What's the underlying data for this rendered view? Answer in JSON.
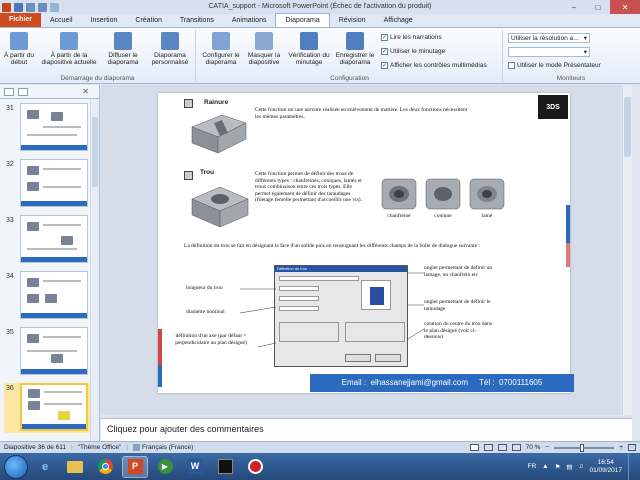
{
  "window": {
    "title": "CATIA_support - Microsoft PowerPoint (Échec de l'activation du produit)"
  },
  "tabs": [
    "Fichier",
    "Accueil",
    "Insertion",
    "Création",
    "Transitions",
    "Animations",
    "Diaporama",
    "Révision",
    "Affichage"
  ],
  "active_tab": "Diaporama",
  "ribbon": {
    "group1": {
      "label": "Démarrage du diaporama",
      "btn_start": "À partir du début",
      "btn_current": "À partir de la diapositive actuelle",
      "btn_broadcast": "Diffuser le diaporama",
      "btn_custom": "Diaporama personnalisé"
    },
    "group2": {
      "label": "Configuration",
      "btn_configure": "Configurer le diaporama",
      "btn_hide": "Masquer la diapositive",
      "btn_timing": "Vérification du minutage",
      "btn_record": "Enregistrer le diaporama",
      "chk_narrations": "Lire les narrations",
      "chk_timing": "Utiliser le minutage",
      "chk_controls": "Afficher les contrôles multimédias"
    },
    "group3": {
      "label": "Moniteurs",
      "resolution_select": "Utiliser la résolution a...",
      "show_on": "",
      "presenter_view": "Utiliser le mode Présentateur"
    }
  },
  "thumbnails": [
    {
      "num": "31"
    },
    {
      "num": "32"
    },
    {
      "num": "33"
    },
    {
      "num": "34"
    },
    {
      "num": "35"
    },
    {
      "num": "36"
    }
  ],
  "slide": {
    "rainure_title": "Rainure",
    "rainure_text": "Cette fonction est une nervure réalisée en enlèvement de matière. Les deux fonctions nécessitent les mêmes paramètres.",
    "trou_title": "Trou",
    "trou_text": "Cette fonction permet de définir des trous de différents types : chanfreinés, coniques, lamés et trous combinaison entre ces trois types. Elle permet également de définir des taraudages (filetage femelle permettant d'accueillir une vis).",
    "hole_types": [
      "chanfreiné",
      "conique",
      "lamé"
    ],
    "definition_text": "La définition du trou se fait en désignant la face d'un solide puis en renseignant les différents champs de la boîte de dialogue suivante :",
    "dialog_title": "Définition du trou",
    "callouts": {
      "longueur": "longueur du trou",
      "diametre": "diamètre nominal",
      "axe": "définition d'un axe (par défaut = perpendiculaire au plan désigné)",
      "onglet_type": "onglet permettant de définir un lamage, un chanfrein etc",
      "onglet_taraudage": "onglet permettant de définir le taraudage",
      "cotation": "cotation du centre du trou dans le plan désigné (voir ci-dessous)"
    },
    "footer": "Email :  elhassanejjami@gmail.com     Tél :  0700111605"
  },
  "notes": {
    "placeholder": "Cliquez pour ajouter des commentaires"
  },
  "status": {
    "slide_info": "Diapositive 36 de 611",
    "theme": "\"Thème Office\"",
    "language": "Français (France)",
    "zoom": "70 %"
  },
  "taskbar": {
    "lang": "FR",
    "time": "16:54",
    "date": "01/09/2017"
  },
  "colors": {
    "file_tab": "#cf4a1f",
    "footer_bar": "#2a6bbf",
    "selected_thumb": "#f5c842"
  }
}
